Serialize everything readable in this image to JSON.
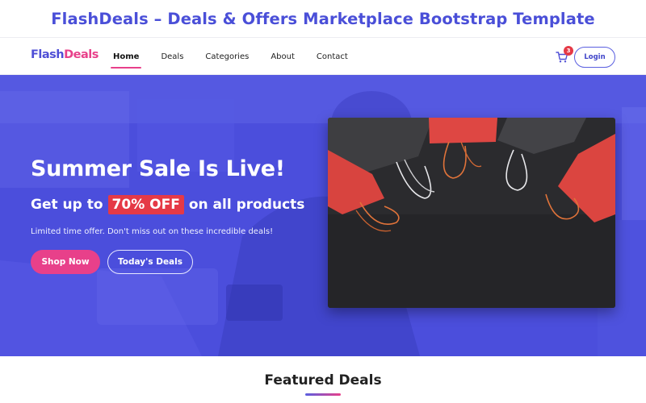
{
  "banner": {
    "title": "FlashDeals – Deals & Offers Marketplace Bootstrap Template"
  },
  "navbar": {
    "logo_part1": "Flash",
    "logo_part2": "Deals",
    "links": [
      "Home",
      "Deals",
      "Categories",
      "About",
      "Contact"
    ],
    "active_link": "Home",
    "cart_count": "3",
    "login_label": "Login"
  },
  "hero": {
    "heading": "Summer Sale Is Live!",
    "sub_prefix": "Get up to",
    "sub_highlight": "70% OFF",
    "sub_suffix": "on all products",
    "description": "Limited time offer. Don't miss out on these incredible deals!",
    "primary_button": "Shop Now",
    "secondary_button": "Today's Deals"
  },
  "featured": {
    "title": "Featured Deals"
  },
  "colors": {
    "brand_blue": "#4f4fd6",
    "brand_pink": "#e8408a",
    "badge_red": "#e53946",
    "hero_bg": "#4c4fde"
  }
}
